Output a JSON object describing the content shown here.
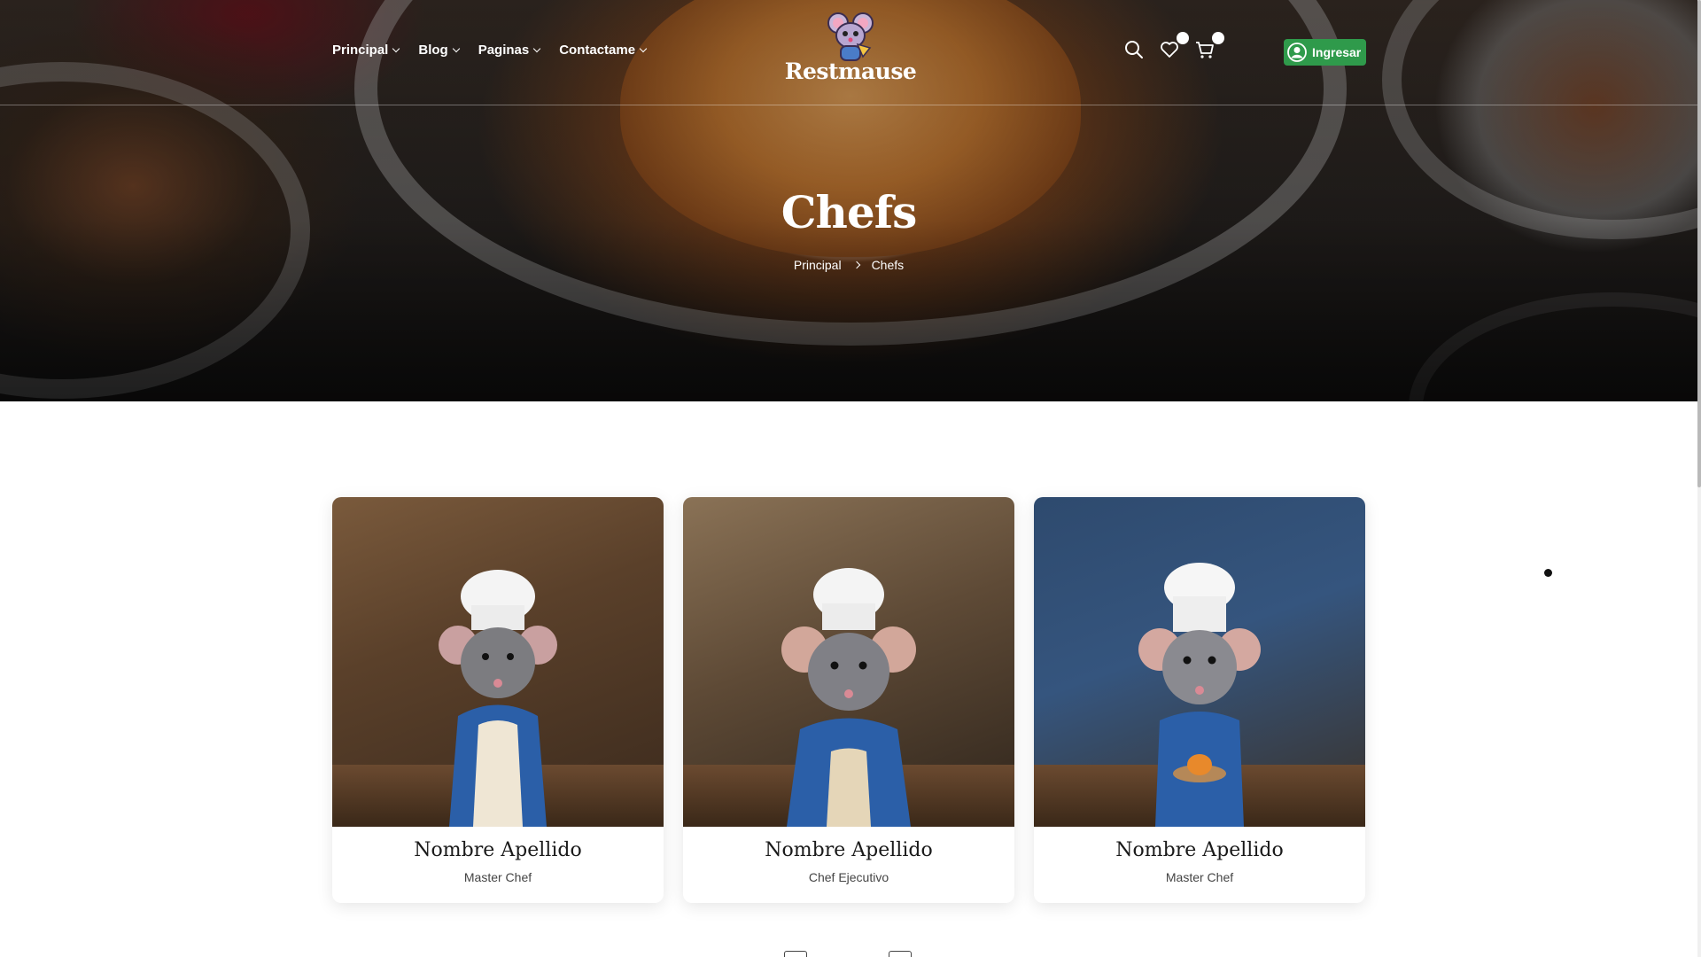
{
  "nav": {
    "menu": [
      {
        "label": "Principal"
      },
      {
        "label": "Blog"
      },
      {
        "label": "Paginas"
      },
      {
        "label": "Contactame"
      }
    ],
    "logo_text": "Restmause",
    "login_label": "Ingresar"
  },
  "hero": {
    "title": "Chefs",
    "breadcrumb": [
      "Principal",
      "Chefs"
    ]
  },
  "chefs": [
    {
      "name": "Nombre Apellido",
      "role": "Master Chef"
    },
    {
      "name": "Nombre Apellido",
      "role": "Chef Ejecutivo"
    },
    {
      "name": "Nombre Apellido",
      "role": "Master Chef"
    }
  ],
  "colors": {
    "accent_green": "#2f9a4b",
    "chef_coat_blue": "#2b5fa8"
  },
  "icons": [
    "search-icon",
    "heart-icon",
    "cart-icon",
    "user-icon"
  ]
}
